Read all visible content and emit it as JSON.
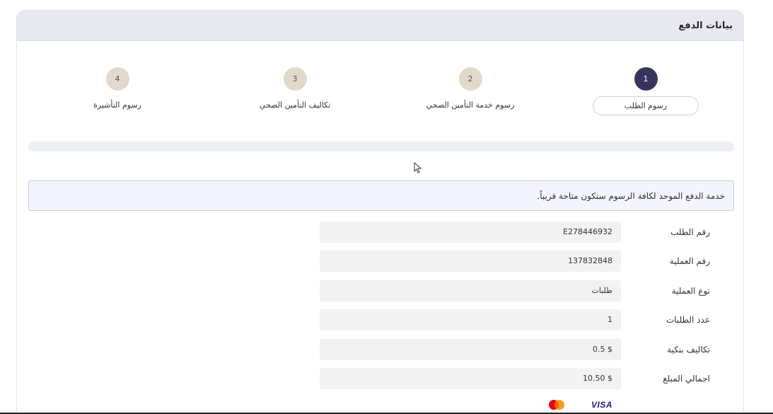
{
  "header": {
    "title": "بيانات الدفع"
  },
  "steps": [
    {
      "number": "1",
      "label": "رسوم الطلب",
      "active": true
    },
    {
      "number": "2",
      "label": "رسوم خدمة التأمين الصحي",
      "active": false
    },
    {
      "number": "3",
      "label": "تكاليف التأمين الصحي",
      "active": false
    },
    {
      "number": "4",
      "label": "رسوم التأشيرة",
      "active": false
    }
  ],
  "notice": {
    "text": "خدمة الدفع الموحد لكافة الرسوم ستكون متاحة قريباً."
  },
  "details": [
    {
      "label": "رقم الطلب",
      "value": "E278446932"
    },
    {
      "label": "رقم العملية",
      "value": "137832848"
    },
    {
      "label": "نوع العملية",
      "value": "طلبات"
    },
    {
      "label": "عدد الطلبات",
      "value": "1"
    },
    {
      "label": "تكاليف بنكية",
      "value": "$ 0.5"
    },
    {
      "label": "اجمالي المبلغ",
      "value": "$ 10.50"
    }
  ],
  "payment_methods": {
    "visa_label": "VISA",
    "mastercard_icon": "mastercard-icon"
  },
  "colors": {
    "active_step": "#34345c",
    "inactive_step": "#e2d8cc",
    "header_bg": "#e8e9f0",
    "notice_bg": "#f3f4fd"
  }
}
